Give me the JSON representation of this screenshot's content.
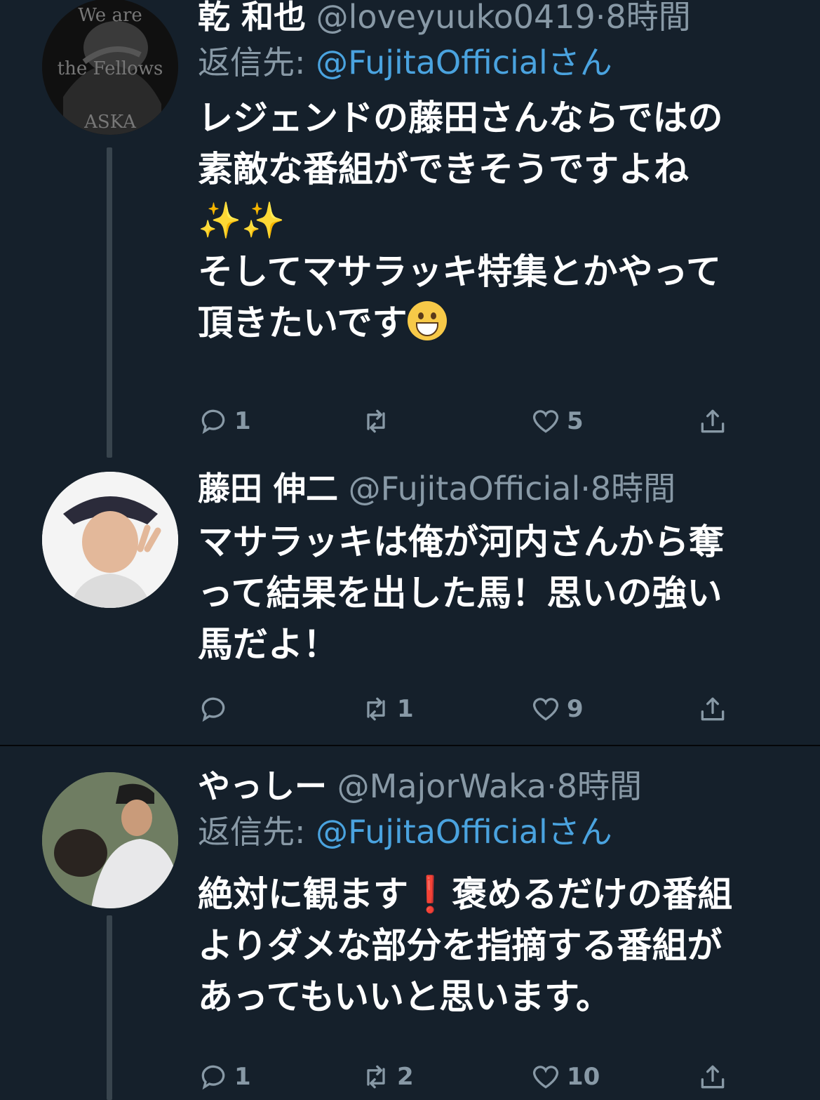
{
  "colors": {
    "background": "#15202b",
    "text": "#ffffff",
    "muted": "#8899a6",
    "link": "#4aa3df",
    "line": "#38444d"
  },
  "tweets": [
    {
      "avatar_text": [
        "We are",
        "the Fellows",
        "ASKA"
      ],
      "name": "乾 和也",
      "handle": "@loveyuuko0419",
      "time": "8時間",
      "reply_prefix": "返信先:",
      "reply_to": "@FujitaOfficialさん",
      "lines": [
        "レジェンドの藤田さんならではの",
        "素敵な番組ができそうですよね",
        "✨✨",
        "そしてマサラッキ特集とかやって",
        "頂きたいです"
      ],
      "replies": "1",
      "retweets": "",
      "likes": "5"
    },
    {
      "name": "藤田 伸二",
      "handle": "@FujitaOfficial",
      "time": "8時間",
      "lines": [
        "マサラッキは俺が河内さんから奪",
        "って結果を出した馬！思いの強い",
        "馬だよ！"
      ],
      "replies": "",
      "retweets": "1",
      "likes": "9"
    },
    {
      "name": "やっしー",
      "handle": "@MajorWaka",
      "time": "8時間",
      "reply_prefix": "返信先:",
      "reply_to": "@FujitaOfficialさん",
      "lines": [
        "絶対に観ます",
        "褒めるだけの番組",
        "よりダメな部分を指摘する番組が",
        "あってもいいと思います。"
      ],
      "replies": "1",
      "retweets": "2",
      "likes": "10"
    }
  ]
}
